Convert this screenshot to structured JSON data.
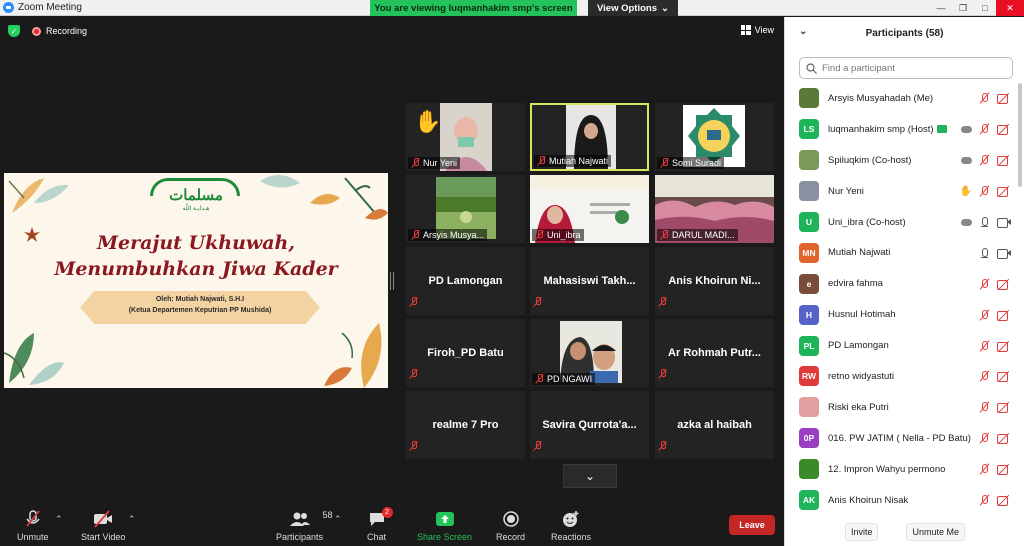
{
  "window": {
    "title": "Zoom Meeting",
    "viewing_banner": "You are viewing luqmanhakim smp's screen",
    "view_options": "View Options"
  },
  "meeting": {
    "recording_label": "Recording",
    "view_label": "View"
  },
  "slide": {
    "logo_text": "مسلمات",
    "logo_sub": "هـدايـة اللّه",
    "title_line1": "Merajut Ukhuwah,",
    "title_line2": "Menumbuhkan Jiwa Kader",
    "speaker_line1": "Oleh: Mutiah Najwati, S.H.I",
    "speaker_line2": "(Ketua Departemen Keputrian PP Mushida)"
  },
  "tiles": [
    {
      "name": "Nur Yeni",
      "kind": "video-hand"
    },
    {
      "name": "Mutiah Najwati",
      "kind": "video-active"
    },
    {
      "name": "Somi Suradi",
      "kind": "video-logo"
    },
    {
      "name": "Arsyis Musya...",
      "kind": "video-garden"
    },
    {
      "name": "Uni_ibra",
      "kind": "video-slide"
    },
    {
      "name": "DARUL MADI...",
      "kind": "video-crowd"
    },
    {
      "name": "PD Lamongan",
      "kind": "name"
    },
    {
      "name": "Mahasiswi Takh...",
      "kind": "name"
    },
    {
      "name": "Anis Khoirun Ni...",
      "kind": "name"
    },
    {
      "name": "Firoh_PD Batu",
      "kind": "name"
    },
    {
      "name": "PD NGAWI",
      "kind": "video-selfie"
    },
    {
      "name": "Ar Rohmah Putr...",
      "kind": "name"
    },
    {
      "name": "realme 7 Pro",
      "kind": "name"
    },
    {
      "name": "Savira Qurrota'a...",
      "kind": "name"
    },
    {
      "name": "azka al haibah",
      "kind": "name"
    }
  ],
  "toolbar": {
    "unmute": "Unmute",
    "start_video": "Start Video",
    "participants": "Participants",
    "participants_count": "58",
    "chat": "Chat",
    "chat_badge": "2",
    "share_screen": "Share Screen",
    "record": "Record",
    "reactions": "Reactions",
    "leave": "Leave"
  },
  "panel": {
    "title": "Participants (58)",
    "search_placeholder": "Find a participant",
    "invite": "Invite",
    "unmute_me": "Unmute Me",
    "participants": [
      {
        "name": "Arsyis Musyahadah (Me)",
        "initials": "",
        "color": "#5a7a3a",
        "mic": "off",
        "video": "off",
        "extra": ""
      },
      {
        "name": "luqmanhakim smp (Host)",
        "initials": "LS",
        "color": "#1eb459",
        "mic": "off",
        "video": "off",
        "extra": "cloud"
      },
      {
        "name": "Spiluqkim (Co-host)",
        "initials": "",
        "color": "#7a9a5a",
        "mic": "off",
        "video": "off",
        "extra": "cloud"
      },
      {
        "name": "Nur Yeni",
        "initials": "",
        "color": "#8a90a0",
        "mic": "off",
        "video": "off",
        "extra": "hand"
      },
      {
        "name": "Uni_ibra (Co-host)",
        "initials": "U",
        "color": "#1eb459",
        "mic": "on",
        "video": "on",
        "extra": "cloud"
      },
      {
        "name": "Mutiah Najwati",
        "initials": "MN",
        "color": "#e0652a",
        "mic": "on",
        "video": "on",
        "extra": ""
      },
      {
        "name": "edvira fahma",
        "initials": "e",
        "color": "#7a4a3a",
        "mic": "off",
        "video": "off",
        "extra": ""
      },
      {
        "name": "Husnul Hotimah",
        "initials": "H",
        "color": "#5563c9",
        "mic": "off",
        "video": "off",
        "extra": ""
      },
      {
        "name": "PD Lamongan",
        "initials": "PL",
        "color": "#1eb459",
        "mic": "off",
        "video": "off",
        "extra": ""
      },
      {
        "name": "retno widyastuti",
        "initials": "RW",
        "color": "#e03b3b",
        "mic": "off",
        "video": "off",
        "extra": ""
      },
      {
        "name": "Riski eka Putri",
        "initials": "",
        "color": "#e0a0a0",
        "mic": "off",
        "video": "off",
        "extra": ""
      },
      {
        "name": "016. PW JATIM ( Nella - PD Batu)",
        "initials": "0P",
        "color": "#9b3fc2",
        "mic": "off",
        "video": "off",
        "extra": ""
      },
      {
        "name": "12. Impron Wahyu permono",
        "initials": "",
        "color": "#3a8a2a",
        "mic": "off",
        "video": "off",
        "extra": ""
      },
      {
        "name": "Anis Khoirun Nisak",
        "initials": "AK",
        "color": "#1eb459",
        "mic": "off",
        "video": "off",
        "extra": ""
      }
    ]
  }
}
